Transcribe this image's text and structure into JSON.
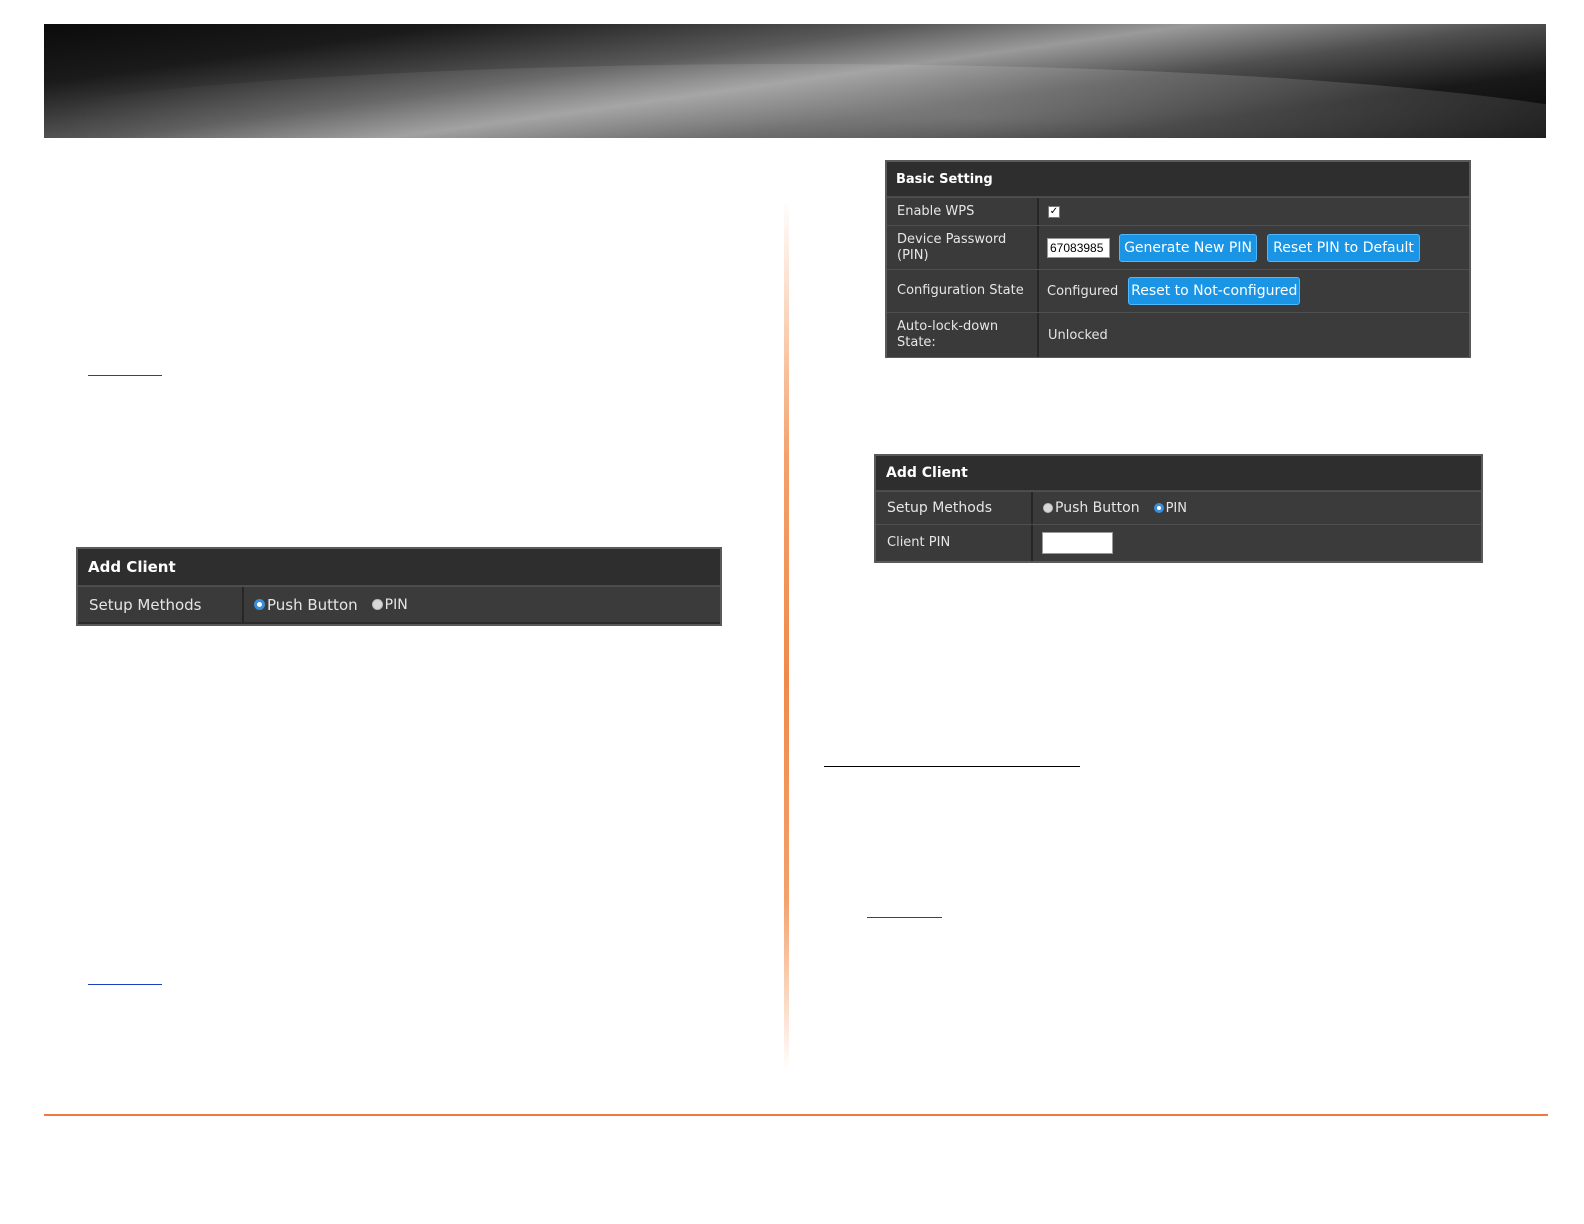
{
  "basic_setting": {
    "title": "Basic Setting",
    "enable_wps": {
      "label": "Enable WPS",
      "checked_glyph": "✓"
    },
    "device_password": {
      "label_line1": "Device Password",
      "label_line2": "(PIN)",
      "pin_value": "67083985",
      "generate_button": "Generate New PIN",
      "reset_button": "Reset PIN to Default"
    },
    "configuration_state": {
      "label": "Configuration State",
      "value": "Configured",
      "reset_button": "Reset to Not-configured"
    },
    "auto_lock": {
      "label_line1": "Auto-lock-down",
      "label_line2": "State:",
      "value": "Unlocked"
    }
  },
  "add_client_push": {
    "title": "Add Client",
    "setup_methods_label": "Setup Methods",
    "option_push": "Push Button",
    "option_pin": "PIN",
    "selected": "Push Button"
  },
  "add_client_pin": {
    "title": "Add Client",
    "setup_methods_label": "Setup Methods",
    "option_push": "Push Button",
    "option_pin": "PIN",
    "selected": "PIN",
    "client_pin_label": "Client PIN",
    "client_pin_value": ""
  },
  "colors": {
    "accent_orange": "#ee7b3a",
    "button_blue": "#1a95e6",
    "panel_dark": "#2b2b2b"
  }
}
